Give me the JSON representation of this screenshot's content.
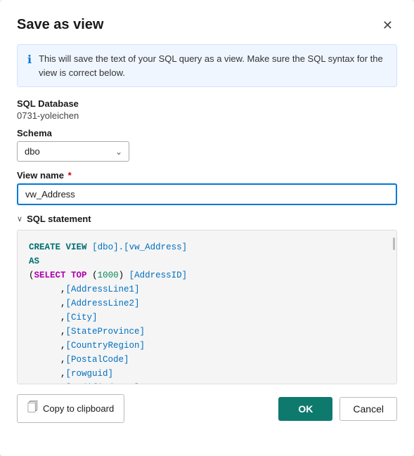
{
  "dialog": {
    "title": "Save as view",
    "close_label": "✕"
  },
  "banner": {
    "icon": "ℹ",
    "text": "This will save the text of your SQL query as a view. Make sure the SQL syntax for the view is correct below."
  },
  "db_section": {
    "label": "SQL Database",
    "value": "0731-yoleichen"
  },
  "schema_section": {
    "label": "Schema",
    "options": [
      "dbo"
    ],
    "selected": "dbo"
  },
  "viewname_section": {
    "label": "View name",
    "required": true,
    "value": "vw_Address",
    "placeholder": ""
  },
  "sql_section": {
    "chevron": "∨",
    "label": "SQL statement",
    "lines": [
      {
        "type": "create_view",
        "text": "CREATE VIEW [dbo].[vw_Address]"
      },
      {
        "type": "as",
        "text": "AS"
      },
      {
        "type": "select_top",
        "text": "(SELECT TOP (1000) [AddressID]"
      },
      {
        "type": "col",
        "text": "      ,[AddressLine1]"
      },
      {
        "type": "col",
        "text": "      ,[AddressLine2]"
      },
      {
        "type": "col",
        "text": "      ,[City]"
      },
      {
        "type": "col",
        "text": "      ,[StateProvince]"
      },
      {
        "type": "col",
        "text": "      ,[CountryRegion]"
      },
      {
        "type": "col",
        "text": "      ,[PostalCode]"
      },
      {
        "type": "col",
        "text": "      ,[rowguid]"
      },
      {
        "type": "col",
        "text": "      ,[ModifiedDate]"
      }
    ]
  },
  "footer": {
    "copy_label": "Copy to clipboard",
    "ok_label": "OK",
    "cancel_label": "Cancel"
  }
}
